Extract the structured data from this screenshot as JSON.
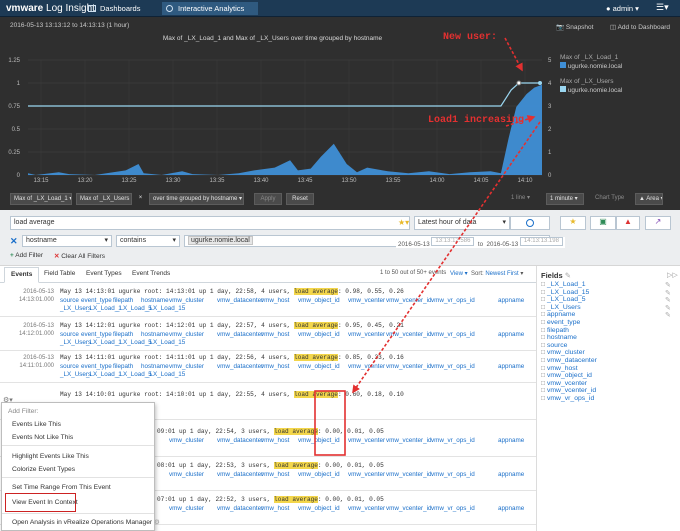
{
  "header": {
    "brand_main": "vmware",
    "brand_app": "Log Insight",
    "tabs": [
      {
        "label": "Dashboards"
      },
      {
        "label": "Interactive Analytics"
      }
    ],
    "user": "admin",
    "colors": {
      "bar": "#1d3a55",
      "active_tab": "#2f5a80"
    }
  },
  "chart_header": {
    "time_range": "2016-05-13   13:13:12   to   14:13:13   (1 hour)",
    "title": "Max of _LX_Load_1 and Max of _LX_Users over time grouped by hostname",
    "snapshot": "Snapshot",
    "add_dashboard": "Add to Dashboard"
  },
  "annotations": {
    "new_user": "New user:",
    "load_increasing": "Load1 increasing",
    "color": "#cc2222"
  },
  "chart_data": {
    "type": "area",
    "title": "Max of _LX_Load_1 and Max of _LX_Users over time grouped by hostname",
    "x_ticks": [
      "13:15",
      "13:20",
      "13:25",
      "13:30",
      "13:35",
      "13:40",
      "13:45",
      "13:50",
      "13:55",
      "14:00",
      "14:05",
      "14:10"
    ],
    "y_left": {
      "ticks": [
        "1.25",
        "1",
        "0.75",
        "0.5",
        "0.25",
        "0"
      ],
      "range": [
        0,
        1.25
      ]
    },
    "y_right": {
      "ticks": [
        "5",
        "4",
        "3",
        "2",
        "1",
        "0"
      ],
      "range": [
        0,
        5
      ]
    },
    "series": [
      {
        "name": "Max of _LX_Load_1",
        "host": "ugurke.nomie.local",
        "color": "#3f8fd6",
        "points": [
          [
            0,
            0.02
          ],
          [
            0.015,
            0
          ],
          [
            0.06,
            0.03
          ],
          [
            0.08,
            0.01
          ],
          [
            0.13,
            0
          ],
          [
            0.19,
            0.05
          ],
          [
            0.215,
            0.12
          ],
          [
            0.225,
            0.02
          ],
          [
            0.26,
            0
          ],
          [
            0.3,
            0.04
          ],
          [
            0.32,
            0.01
          ],
          [
            0.37,
            0
          ],
          [
            0.41,
            0.02
          ],
          [
            0.44,
            0.05
          ],
          [
            0.48,
            0.08
          ],
          [
            0.51,
            0.16
          ],
          [
            0.525,
            0.05
          ],
          [
            0.55,
            0.07
          ],
          [
            0.57,
            0.2
          ],
          [
            0.595,
            0.34
          ],
          [
            0.62,
            0.12
          ],
          [
            0.64,
            0.03
          ],
          [
            0.66,
            0.08
          ],
          [
            0.7,
            0.04
          ],
          [
            0.74,
            0.02
          ],
          [
            0.78,
            0.04
          ],
          [
            0.82,
            0.01
          ],
          [
            0.86,
            0.03
          ],
          [
            0.9,
            0.04
          ],
          [
            0.92,
            0.02
          ],
          [
            0.935,
            0.4
          ],
          [
            0.95,
            0.74
          ],
          [
            0.97,
            0.88
          ],
          [
            0.985,
            0.95
          ],
          [
            1,
            0.98
          ]
        ]
      },
      {
        "name": "Max of _LX_Users",
        "host": "ugurke.nomie.local",
        "color": "#9ad6f0",
        "points": [
          [
            0,
            3
          ],
          [
            0.92,
            3
          ],
          [
            0.94,
            3.7
          ],
          [
            0.955,
            4
          ],
          [
            0.97,
            4
          ],
          [
            1,
            4
          ]
        ]
      }
    ],
    "legend": [
      {
        "label": "Max of _LX_Load_1",
        "host": "ugurke.nomie.local",
        "color": "#3f8fd6"
      },
      {
        "label": "Max of _LX_Users",
        "host": "ugurke.nomie.local",
        "color": "#9ad6f0"
      }
    ],
    "legend_placement": "right",
    "grid": true
  },
  "chart_toolbar": {
    "agg1": "Max of _LX_Load_1",
    "agg2": "Max of _LX_Users",
    "close": "×",
    "group": "over time grouped by hostname",
    "apply": "Apply",
    "reset": "Reset",
    "time_prefix": "1 line",
    "interval": "1 minute",
    "chart_type_label": "Chart Type",
    "chart_type": "Area"
  },
  "query": {
    "text": "load average",
    "time_select": "Latest hour of data",
    "filter_field": "hostname",
    "filter_op": "contains",
    "filter_value": "ugurke.nomie.local",
    "add_filter": "Add Filter",
    "clear_filters": "Clear All Filters",
    "from": "2016-05-13",
    "from_time": "13:13:12.586",
    "to_word": "to",
    "to": "2016-05-13",
    "to_time": "14:13:13.198"
  },
  "tabs": {
    "items": [
      "Events",
      "Field Table",
      "Event Types",
      "Event Trends"
    ],
    "count": "1 to 50 out of 50+ events",
    "view": "View",
    "sort_label": "Sort:",
    "sort_value": "Newest First"
  },
  "event_fields": [
    "source",
    "event_type",
    "filepath",
    "hostname",
    "vmw_cluster",
    "vmw_datacenter",
    "vmw_host",
    "vmw_object_id",
    "vmw_vcenter",
    "vmw_vcenter_id",
    "vmw_vr_ops_id",
    "appname"
  ],
  "event_fields_2": [
    "_LX_Users",
    "_LX_Load_1",
    "_LX_Load_5",
    "_LX_Load_15"
  ],
  "events": [
    {
      "date": "2016-05-13",
      "time": "14:13:01.000",
      "pre": "May 13 14:13:01 ugurke root:  14:13:01 up 1 day, 22:58,  4 users,  ",
      "hl": "load average",
      "post": ": 0.98, 0.55, 0.26"
    },
    {
      "date": "2016-05-13",
      "time": "14:12:01.000",
      "pre": "May 13 14:12:01 ugurke root:  14:12:01 up 1 day, 22:57,  4 users,  ",
      "hl": "load average",
      "post": ": 0.95, 0.45, 0.21"
    },
    {
      "date": "2016-05-13",
      "time": "14:11:01.000",
      "pre": "May 13 14:11:01 ugurke root:  14:11:01 up 1 day, 22:56,  4 users,  ",
      "hl": "load average",
      "post": ": 0.85, 0.33, 0.16"
    },
    {
      "date": "",
      "time": "",
      "pre": "May 13 14:10:01 ugurke root:  14:10:01 up 1 day, 22:55,  4 users,  ",
      "hl": "load average",
      "post": ": 0.60, 0.18, 0.10"
    },
    {
      "date": "",
      "time": "",
      "pre": "09:01 up 1 day, 22:54,  3 users,  ",
      "hl": "load average",
      "post": ": 0.00, 0.01, 0.05"
    },
    {
      "date": "",
      "time": "",
      "pre": "08:01 up 1 day, 22:53,  3 users,  ",
      "hl": "load average",
      "post": ": 0.00, 0.01, 0.05"
    },
    {
      "date": "",
      "time": "",
      "pre": "07:01 up 1 day, 22:52,  3 users,  ",
      "hl": "load average",
      "post": ": 0.00, 0.01, 0.05"
    }
  ],
  "fields_panel": {
    "title": "Fields",
    "items": [
      "_LX_Load_1",
      "_LX_Load_15",
      "_LX_Load_5",
      "_LX_Users",
      "appname",
      "event_type",
      "filepath",
      "hostname",
      "source",
      "vmw_cluster",
      "vmw_datacenter",
      "vmw_host",
      "vmw_object_id",
      "vmw_vcenter",
      "vmw_vcenter_id",
      "vmw_vr_ops_id"
    ]
  },
  "context_menu": {
    "heading": "Add Filter:",
    "items": [
      "Events Like This",
      "Events Not Like This",
      "Highlight Events Like This",
      "Colorize Event Types",
      "Set Time Range From This Event",
      "View Event In Context",
      "Open Analysis in vRealize Operations Manager"
    ],
    "highlight_color": "#cc2222"
  }
}
